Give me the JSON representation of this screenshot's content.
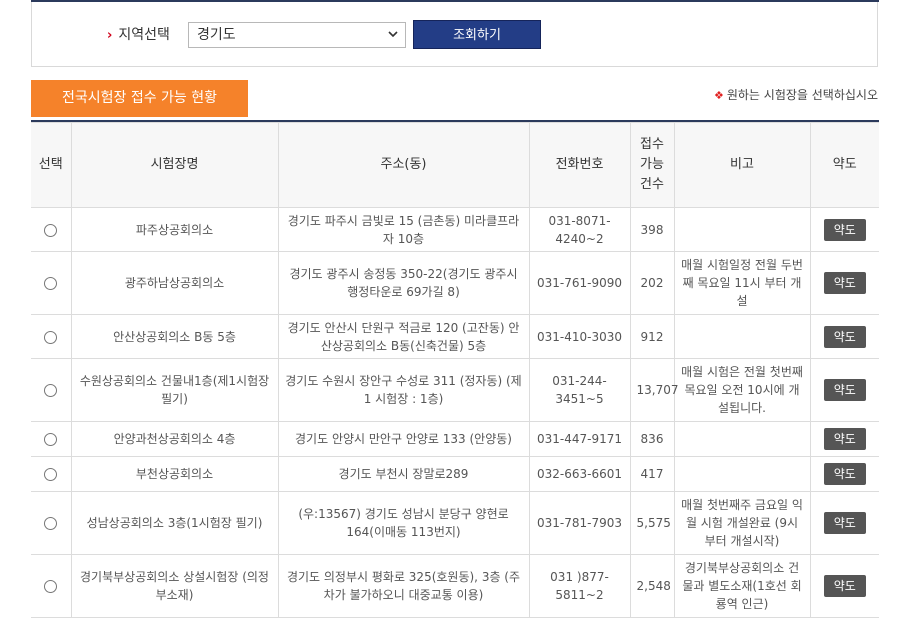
{
  "search": {
    "region_label": "지역선택",
    "region_value": "경기도",
    "search_button": "조회하기"
  },
  "section": {
    "tab_title": "전국시험장 접수 가능 현황",
    "notice": "원하는 시험장을 선택하십시오"
  },
  "table": {
    "headers": {
      "select": "선택",
      "name": "시험장명",
      "address": "주소(동)",
      "phone": "전화번호",
      "count_1": "접수",
      "count_2": "가능",
      "count_3": "건수",
      "note": "비고",
      "map": "약도"
    },
    "rows": [
      {
        "name": "파주상공회의소",
        "address": "경기도 파주시 금빛로 15 (금촌동) 미라클프라자 10층",
        "phone": "031-8071-4240~2",
        "count": "398",
        "note": "",
        "map": "약도"
      },
      {
        "name": "광주하남상공회의소",
        "address": "경기도 광주시 송정동 350-22(경기도 광주시 행정타운로 69가길 8)",
        "phone": "031-761-9090",
        "count": "202",
        "note": "매월 시험일정 전월 두번째 목요일 11시 부터 개설",
        "map": "약도"
      },
      {
        "name": "안산상공회의소 B동 5층",
        "address": "경기도 안산시 단원구 적금로 120 (고잔동) 안산상공회의소 B동(신축건물) 5층",
        "phone": "031-410-3030",
        "count": "912",
        "note": "",
        "map": "약도"
      },
      {
        "name": "수원상공회의소 건물내1층(제1시험장 필기)",
        "address": "경기도 수원시 장안구 수성로 311 (정자동) (제 1 시험장 : 1층)",
        "phone": "031-244-3451~5",
        "count": "13,707",
        "note": "매월 시험은 전월 첫번째 목요일 오전 10시에 개설됩니다.",
        "map": "약도"
      },
      {
        "name": "안양과천상공회의소 4층",
        "address": "경기도 안양시 만안구 안양로 133 (안양동)",
        "phone": "031-447-9171",
        "count": "836",
        "note": "",
        "map": "약도"
      },
      {
        "name": "부천상공회의소",
        "address": "경기도 부천시 장말로289",
        "phone": "032-663-6601",
        "count": "417",
        "note": "",
        "map": "약도"
      },
      {
        "name": "성남상공회의소 3층(1시험장 필기)",
        "address": "(우:13567) 경기도 성남시 분당구 양현로 164(이매동 113번지)",
        "phone": "031-781-7903",
        "count": "5,575",
        "note": "매월 첫번째주 금요일 익월 시험 개설완료 (9시부터 개설시작)",
        "map": "약도"
      },
      {
        "name": "경기북부상공회의소 상설시험장 (의정부소재)",
        "address": "경기도 의정부시 평화로 325(호원동), 3층 (주차가 불가하오니 대중교통 이용)",
        "phone": "031 )877-5811~2",
        "count": "2,548",
        "note": "경기북부상공회의소 건물과 별도소재(1호선 회룡역 인근)",
        "map": "약도"
      }
    ]
  },
  "colors": {
    "accent_orange": "#f5822a",
    "button_navy": "#233d86",
    "note_red": "#e03c3c"
  }
}
